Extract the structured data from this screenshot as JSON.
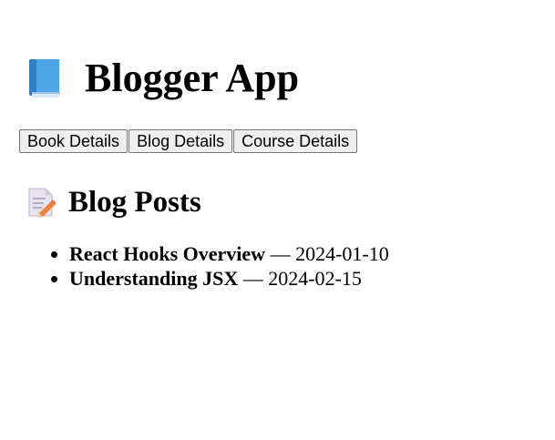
{
  "app": {
    "title": "Blogger App",
    "title_icon": "blue-book-icon"
  },
  "nav": {
    "buttons": [
      {
        "label": "Book Details"
      },
      {
        "label": "Blog Details"
      },
      {
        "label": "Course Details"
      }
    ]
  },
  "blog": {
    "heading": "Blog Posts",
    "heading_icon": "memo-icon",
    "separator": "—",
    "posts": [
      {
        "title": "React Hooks Overview",
        "date": "2024-01-10"
      },
      {
        "title": "Understanding JSX",
        "date": "2024-02-15"
      }
    ]
  },
  "colors": {
    "book_blue": "#3b8fd9",
    "button_bg": "#efefef",
    "button_border": "#767676"
  }
}
